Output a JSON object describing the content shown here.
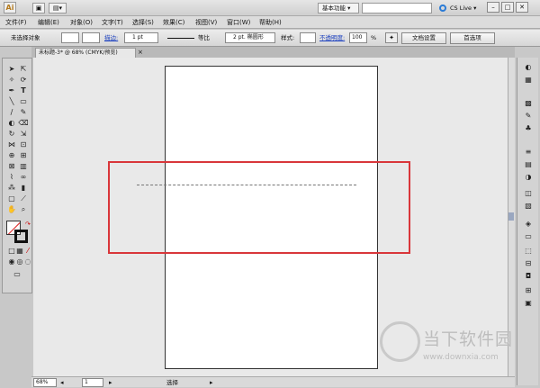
{
  "app": {
    "logo": "Ai"
  },
  "titlebar": {
    "workspace": "基本功能 ▾",
    "cs_live": "CS Live ▾",
    "window_buttons": [
      "–",
      "□",
      "✕"
    ]
  },
  "menu": [
    "文件(F)",
    "编辑(E)",
    "对象(O)",
    "文字(T)",
    "选择(S)",
    "效果(C)",
    "视图(V)",
    "窗口(W)",
    "帮助(H)"
  ],
  "control": {
    "no_selection": "未选择对象",
    "stroke_label": "描边:",
    "stroke_weight": "1 pt",
    "profile": "等比",
    "brush": "2 pt. 椭圆形",
    "style_label": "样式:",
    "opacity_label": "不透明度:",
    "opacity_value": "100",
    "opacity_unit": "%",
    "doc_setup": "文档设置",
    "preferences": "首选项"
  },
  "document": {
    "tab_title": "未标题-3* @ 68% (CMYK/预览)",
    "close": "×"
  },
  "status": {
    "zoom": "68%",
    "page": "1",
    "mode": "选择"
  },
  "watermark": {
    "text": "当下软件园",
    "url": "www.downxia.com"
  },
  "colors": {
    "highlight": "#d9363a",
    "link": "#1a3fbf"
  }
}
